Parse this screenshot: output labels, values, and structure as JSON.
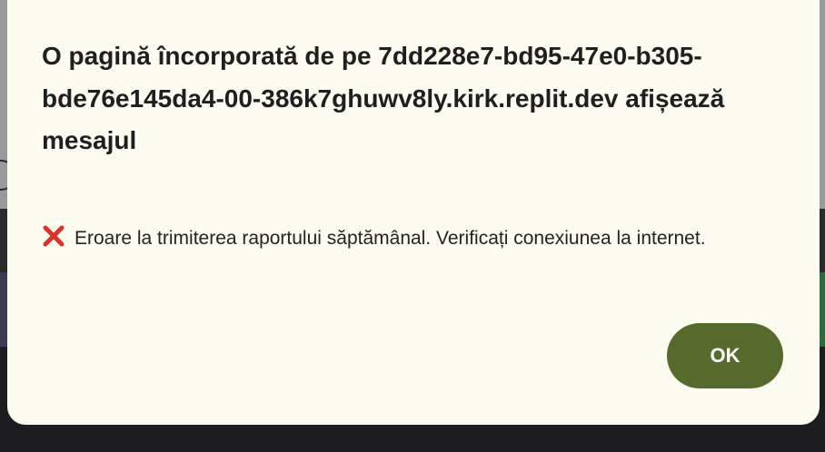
{
  "dialog": {
    "title": "O pagină încorporată de pe 7dd228e7-bd95-47e0-b305-bde76e145da4-00-386k7ghuwv8ly.kirk.replit.dev afișează mesajul",
    "message": "Eroare la trimiterea raportului săptămânal. Verificați conexiunea la internet.",
    "message_icon": "red-x-icon",
    "ok_label": "OK"
  },
  "colors": {
    "dialog_background": "#fcfcf0",
    "ok_button": "#566a2e",
    "error_icon": "#d9342b"
  }
}
